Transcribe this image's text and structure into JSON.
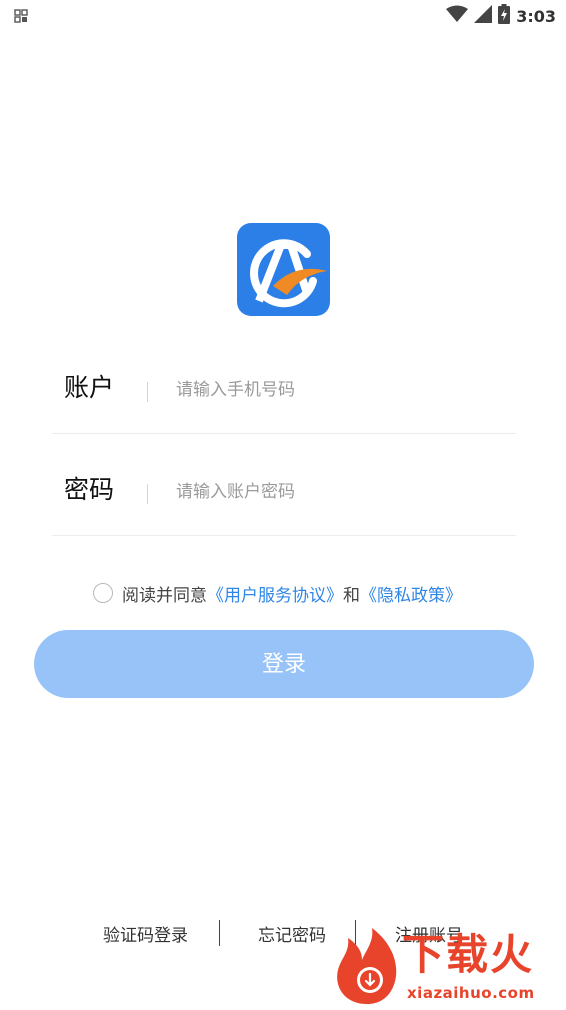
{
  "status_bar": {
    "time": "3:03",
    "icons": [
      "app-grid-icon",
      "wifi-icon",
      "signal-icon",
      "battery-charging-icon"
    ]
  },
  "login": {
    "logo": "app-logo",
    "account": {
      "label": "账户",
      "placeholder": "请输入手机号码",
      "value": ""
    },
    "password": {
      "label": "密码",
      "placeholder": "请输入账户密码",
      "value": ""
    },
    "agreement": {
      "prefix": "阅读并同意",
      "terms_link": "《用户服务协议》",
      "and": "和",
      "privacy_link": "《隐私政策》",
      "checked": false
    },
    "login_button": "登录"
  },
  "bottom_links": {
    "sms_login": "验证码登录",
    "forgot_password": "忘记密码",
    "register": "注册账号"
  },
  "watermark": {
    "title": "下载火",
    "domain": "xiazaihuo.com"
  },
  "colors": {
    "accent": "#2f86e6",
    "button": "#98c3f9",
    "logo_bg": "#2d7fe8",
    "logo_swoosh": "#f08a24",
    "watermark": "#e8442c"
  }
}
